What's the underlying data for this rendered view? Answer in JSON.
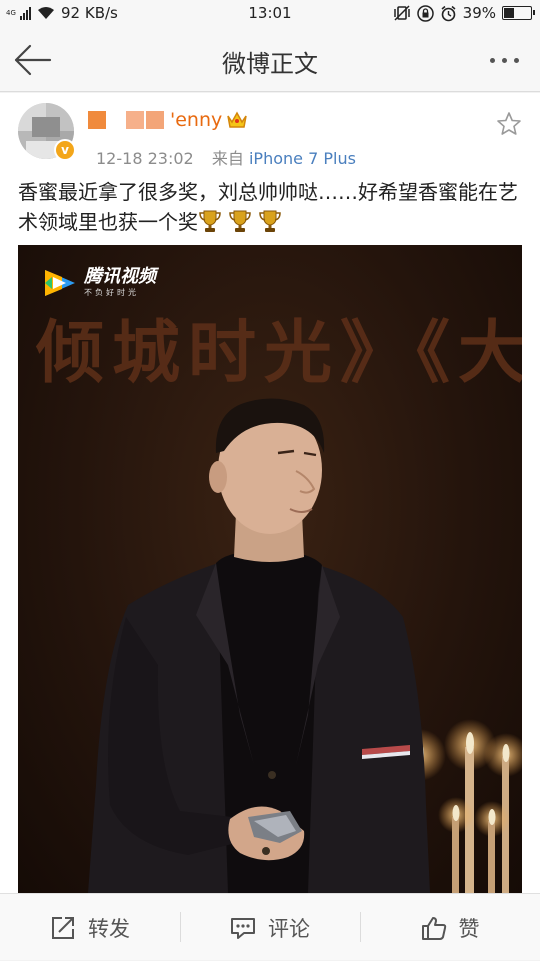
{
  "status_bar": {
    "network": "4G",
    "speed": "92 KB/s",
    "time": "13:01",
    "battery": "39%",
    "battery_level": 0.39
  },
  "nav": {
    "title": "微博正文",
    "back_icon": "back-arrow-icon",
    "more_icon": "more-dots-icon"
  },
  "post": {
    "username": "'enny",
    "time": "12-18 23:02",
    "source_prefix": "来自",
    "source": "iPhone 7 Plus",
    "text": "香蜜最近拿了很多奖，刘总帅帅哒……好希望香蜜能在艺术领域里也获一个奖",
    "trophy_count": 3,
    "image": {
      "logo_main": "腾讯视频",
      "logo_sub": "不负好时光",
      "banner": "倾城时光》《大"
    }
  },
  "actions": [
    {
      "label": "转发",
      "icon": "repost-icon"
    },
    {
      "label": "评论",
      "icon": "comment-icon"
    },
    {
      "label": "赞",
      "icon": "like-icon"
    }
  ],
  "colors": {
    "username": "#e86a10",
    "source": "#4a7fbe",
    "verified": "#f3a61a"
  }
}
